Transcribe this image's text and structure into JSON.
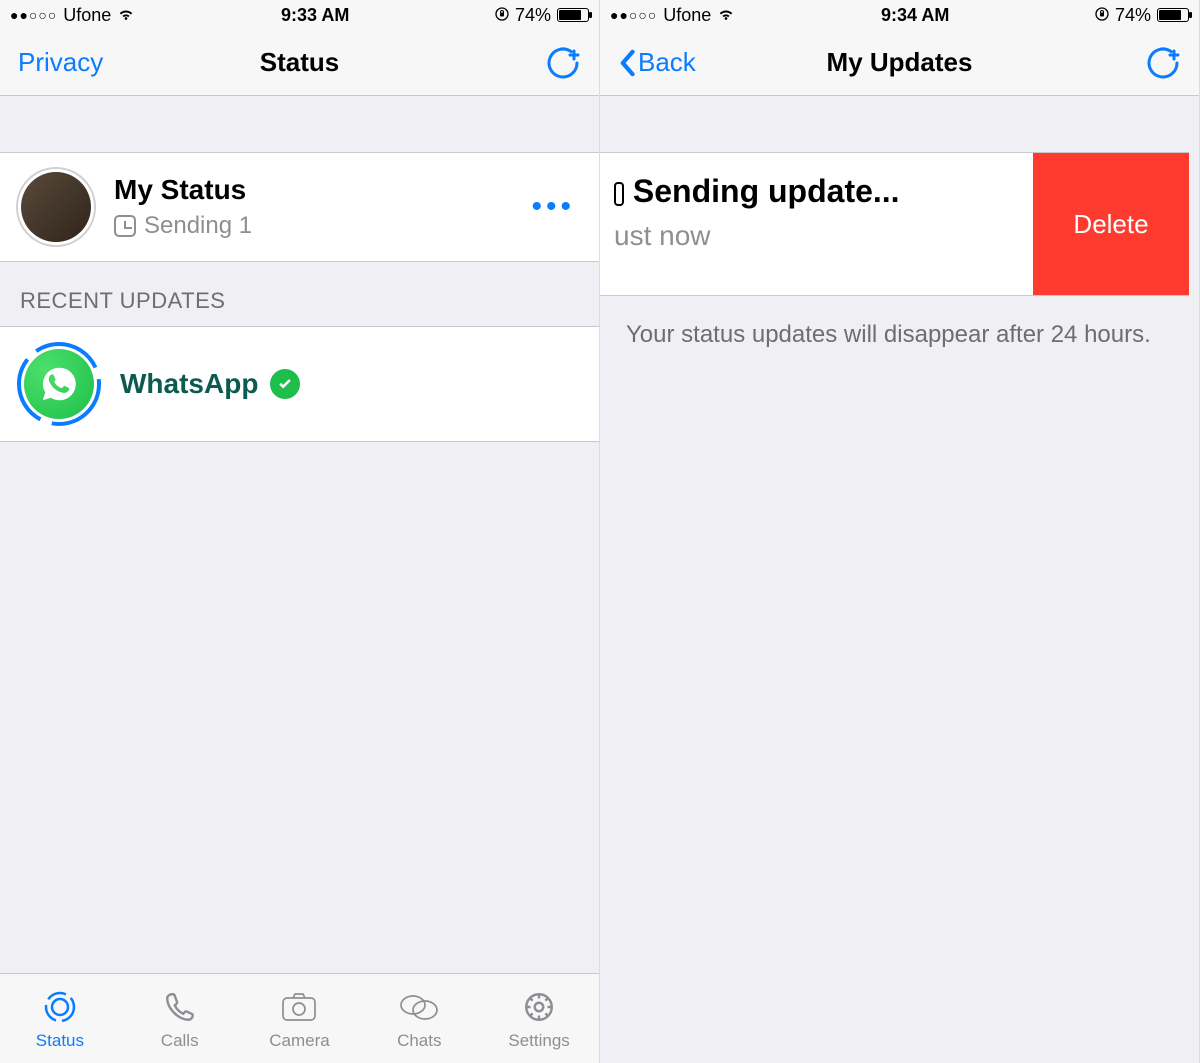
{
  "left": {
    "statusbar": {
      "carrier": "Ufone",
      "time": "9:33 AM",
      "battery": "74%"
    },
    "nav": {
      "left": "Privacy",
      "title": "Status"
    },
    "mystatus": {
      "title": "My Status",
      "subtitle": "Sending 1"
    },
    "section_recent": "RECENT UPDATES",
    "whatsapp_name": "WhatsApp",
    "tabs": [
      {
        "label": "Status",
        "active": true
      },
      {
        "label": "Calls",
        "active": false
      },
      {
        "label": "Camera",
        "active": false
      },
      {
        "label": "Chats",
        "active": false
      },
      {
        "label": "Settings",
        "active": false
      }
    ]
  },
  "right": {
    "statusbar": {
      "carrier": "Ufone",
      "time": "9:34 AM",
      "battery": "74%"
    },
    "nav": {
      "left": "Back",
      "title": "My Updates"
    },
    "row": {
      "title": "Sending update...",
      "subtitle": "ust now",
      "delete": "Delete"
    },
    "footer": "Your status updates will disappear after 24 hours."
  }
}
